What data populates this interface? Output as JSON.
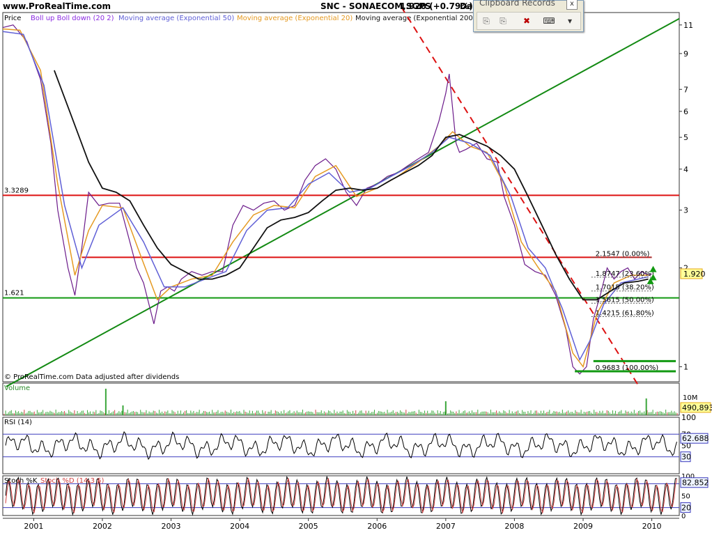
{
  "header": {
    "site": "www.ProRealTime.com",
    "symbol": "SNC - SONAECOM,SGPS",
    "quote": "1.920 (+0.79%)",
    "period": "Dai"
  },
  "legend": {
    "price": "Price",
    "boll": "Boll up Boll down (20 2)",
    "ema50": "Moving average (Exponential 50)",
    "ema20": "Moving average (Exponential 20)",
    "ema200": "Moving average (Exponential 200)"
  },
  "popup": {
    "title": "Clipboard Records",
    "close": "x",
    "buttons": [
      "copy-icon",
      "paste-icon",
      "delete-icon",
      "keyboard-icon",
      "dropdown-icon"
    ]
  },
  "chart_data": {
    "type": "line",
    "title": "SNC - SONAECOM,SGPS",
    "y_scale": "log",
    "ylim": [
      0.9,
      12
    ],
    "x_range": [
      2000.55,
      2010.4
    ],
    "x_tick_labels": [
      "2001",
      "2002",
      "2003",
      "2004",
      "2005",
      "2006",
      "2007",
      "2008",
      "2009",
      "2010"
    ],
    "y_tick_labels": [
      "1",
      "2",
      "3",
      "4",
      "5",
      "6",
      "7",
      "9",
      "11"
    ],
    "y_ticks": [
      1,
      2,
      3,
      4,
      5,
      6,
      7,
      9,
      11
    ],
    "current_price_label": "1.920",
    "footnote": "© ProRealTime.com  Data adjusted after dividends",
    "series": [
      {
        "name": "Price",
        "color": "#6b1a8a",
        "x": [
          2000.55,
          2000.7,
          2000.9,
          2001.1,
          2001.25,
          2001.35,
          2001.5,
          2001.6,
          2001.7,
          2001.8,
          2001.95,
          2002.1,
          2002.25,
          2002.4,
          2002.5,
          2002.6,
          2002.75,
          2002.85,
          2002.95,
          2003.05,
          2003.15,
          2003.3,
          2003.45,
          2003.6,
          2003.75,
          2003.9,
          2004.05,
          2004.2,
          2004.35,
          2004.5,
          2004.65,
          2004.8,
          2004.95,
          2005.1,
          2005.25,
          2005.4,
          2005.55,
          2005.7,
          2005.85,
          2006.0,
          2006.15,
          2006.3,
          2006.45,
          2006.6,
          2006.75,
          2006.9,
          2007.0,
          2007.05,
          2007.15,
          2007.2,
          2007.3,
          2007.45,
          2007.6,
          2007.75,
          2007.85,
          2008.0,
          2008.15,
          2008.3,
          2008.45,
          2008.6,
          2008.75,
          2008.85,
          2008.95,
          2009.05,
          2009.15,
          2009.25,
          2009.35,
          2009.45,
          2009.55,
          2009.65,
          2009.75,
          2009.85,
          2009.95,
          2010.0
        ],
        "y": [
          10.8,
          11.0,
          9.8,
          7.5,
          4.8,
          3.0,
          2.0,
          1.65,
          2.3,
          3.4,
          3.1,
          3.15,
          3.15,
          2.4,
          2.0,
          1.8,
          1.35,
          1.7,
          1.75,
          1.7,
          1.85,
          1.95,
          1.9,
          1.95,
          1.95,
          2.7,
          3.1,
          3.0,
          3.15,
          3.2,
          3.0,
          3.1,
          3.7,
          4.1,
          4.3,
          4.0,
          3.4,
          3.1,
          3.5,
          3.6,
          3.8,
          3.9,
          4.1,
          4.3,
          4.5,
          5.6,
          6.8,
          7.8,
          4.8,
          4.5,
          4.6,
          4.8,
          4.3,
          4.2,
          3.3,
          2.7,
          2.05,
          1.95,
          1.9,
          1.65,
          1.3,
          1.0,
          0.95,
          1.0,
          1.4,
          1.65,
          2.0,
          1.85,
          1.95,
          2.0,
          1.85,
          1.95,
          1.9,
          1.92
        ]
      },
      {
        "name": "Moving average (Exponential 20)",
        "color": "#e59a22",
        "x": [
          2000.55,
          2000.8,
          2001.1,
          2001.35,
          2001.6,
          2001.8,
          2002.0,
          2002.3,
          2002.55,
          2002.8,
          2003.0,
          2003.3,
          2003.6,
          2003.9,
          2004.2,
          2004.5,
          2004.8,
          2005.1,
          2005.4,
          2005.7,
          2006.0,
          2006.3,
          2006.6,
          2006.9,
          2007.1,
          2007.35,
          2007.6,
          2007.85,
          2008.1,
          2008.35,
          2008.6,
          2008.85,
          2009.0,
          2009.2,
          2009.45,
          2009.7,
          2009.95
        ],
        "y": [
          10.7,
          10.6,
          8.0,
          3.6,
          1.9,
          2.6,
          3.1,
          3.05,
          2.2,
          1.6,
          1.75,
          1.85,
          1.9,
          2.4,
          2.9,
          3.1,
          3.05,
          3.8,
          4.1,
          3.3,
          3.5,
          3.8,
          4.2,
          4.7,
          5.2,
          4.7,
          4.5,
          3.6,
          2.4,
          2.0,
          1.7,
          1.1,
          1.0,
          1.45,
          1.8,
          1.9,
          1.9
        ]
      },
      {
        "name": "Moving average (Exponential 50)",
        "color": "#5f5fd6",
        "x": [
          2000.55,
          2000.85,
          2001.15,
          2001.45,
          2001.7,
          2001.95,
          2002.3,
          2002.6,
          2002.9,
          2003.2,
          2003.5,
          2003.8,
          2004.1,
          2004.4,
          2004.7,
          2005.0,
          2005.3,
          2005.6,
          2005.9,
          2006.2,
          2006.5,
          2006.8,
          2007.05,
          2007.35,
          2007.65,
          2007.95,
          2008.2,
          2008.45,
          2008.7,
          2008.95,
          2009.1,
          2009.3,
          2009.55,
          2009.8,
          2009.95
        ],
        "y": [
          10.5,
          10.3,
          7.2,
          3.1,
          2.0,
          2.7,
          3.05,
          2.4,
          1.75,
          1.75,
          1.85,
          1.95,
          2.6,
          3.0,
          3.05,
          3.6,
          3.9,
          3.4,
          3.5,
          3.8,
          4.1,
          4.5,
          5.0,
          4.8,
          4.4,
          3.3,
          2.3,
          2.0,
          1.5,
          1.05,
          1.2,
          1.55,
          1.8,
          1.85,
          1.88
        ]
      },
      {
        "name": "Moving average (Exponential 200)",
        "color": "#111111",
        "x": [
          2001.3,
          2001.55,
          2001.8,
          2002.0,
          2002.2,
          2002.4,
          2002.6,
          2002.8,
          2003.0,
          2003.2,
          2003.4,
          2003.6,
          2003.8,
          2004.0,
          2004.2,
          2004.4,
          2004.6,
          2004.8,
          2005.0,
          2005.2,
          2005.4,
          2005.6,
          2005.8,
          2006.0,
          2006.2,
          2006.4,
          2006.6,
          2006.8,
          2007.0,
          2007.2,
          2007.4,
          2007.6,
          2007.8,
          2008.0,
          2008.2,
          2008.4,
          2008.6,
          2008.8,
          2009.0,
          2009.2,
          2009.4,
          2009.6,
          2009.8,
          2009.95
        ],
        "y": [
          8.0,
          5.8,
          4.2,
          3.5,
          3.4,
          3.2,
          2.7,
          2.3,
          2.05,
          1.95,
          1.85,
          1.85,
          1.9,
          2.0,
          2.3,
          2.65,
          2.8,
          2.85,
          2.95,
          3.2,
          3.45,
          3.5,
          3.45,
          3.5,
          3.7,
          3.9,
          4.1,
          4.4,
          5.0,
          5.1,
          4.9,
          4.7,
          4.4,
          4.0,
          3.3,
          2.7,
          2.2,
          1.85,
          1.6,
          1.6,
          1.7,
          1.8,
          1.82,
          1.85
        ]
      }
    ],
    "lines": [
      {
        "label": "3.3289",
        "y": 3.3289,
        "color": "#dd1111"
      },
      {
        "label": "1.621",
        "y": 1.621,
        "color": "#119911"
      }
    ],
    "fibonacci": {
      "color": "#dd1111",
      "levels": [
        {
          "label": "2.1547 (0.00%)",
          "y": 2.1547
        },
        {
          "label": "1.8747 (23.60%)",
          "y": 1.8747
        },
        {
          "label": "1.7015 (38.20%)",
          "y": 1.7015
        },
        {
          "label": "1.5615 (50.00%)",
          "y": 1.5615
        },
        {
          "label": "1.4215 (61.80%)",
          "y": 1.4215
        },
        {
          "label": "0.9683 (100.00%)",
          "y": 0.9683
        }
      ]
    },
    "trendlines": [
      {
        "color": "#138a13",
        "from": [
          2000.6,
          0.87
        ],
        "to": [
          2010.4,
          11.5
        ]
      },
      {
        "color": "#dd1111",
        "dash": true,
        "from": [
          2006.35,
          12.5
        ],
        "to": [
          2009.8,
          0.88
        ]
      }
    ],
    "volume": {
      "title": "Volume",
      "scale_label": "10M",
      "last_label": "490,893"
    },
    "rsi": {
      "title": "RSI (14)",
      "labels": [
        "100",
        "70",
        "50",
        "30"
      ],
      "last_label": "62.688",
      "lower_label": "30"
    },
    "stoch": {
      "title_k": "Stoch %K",
      "title_d": "Stoch %D (14 3 5)",
      "labels": [
        "100",
        "80",
        "50",
        "20",
        "0"
      ],
      "last_label": "82.852",
      "lower_label": "20"
    }
  }
}
